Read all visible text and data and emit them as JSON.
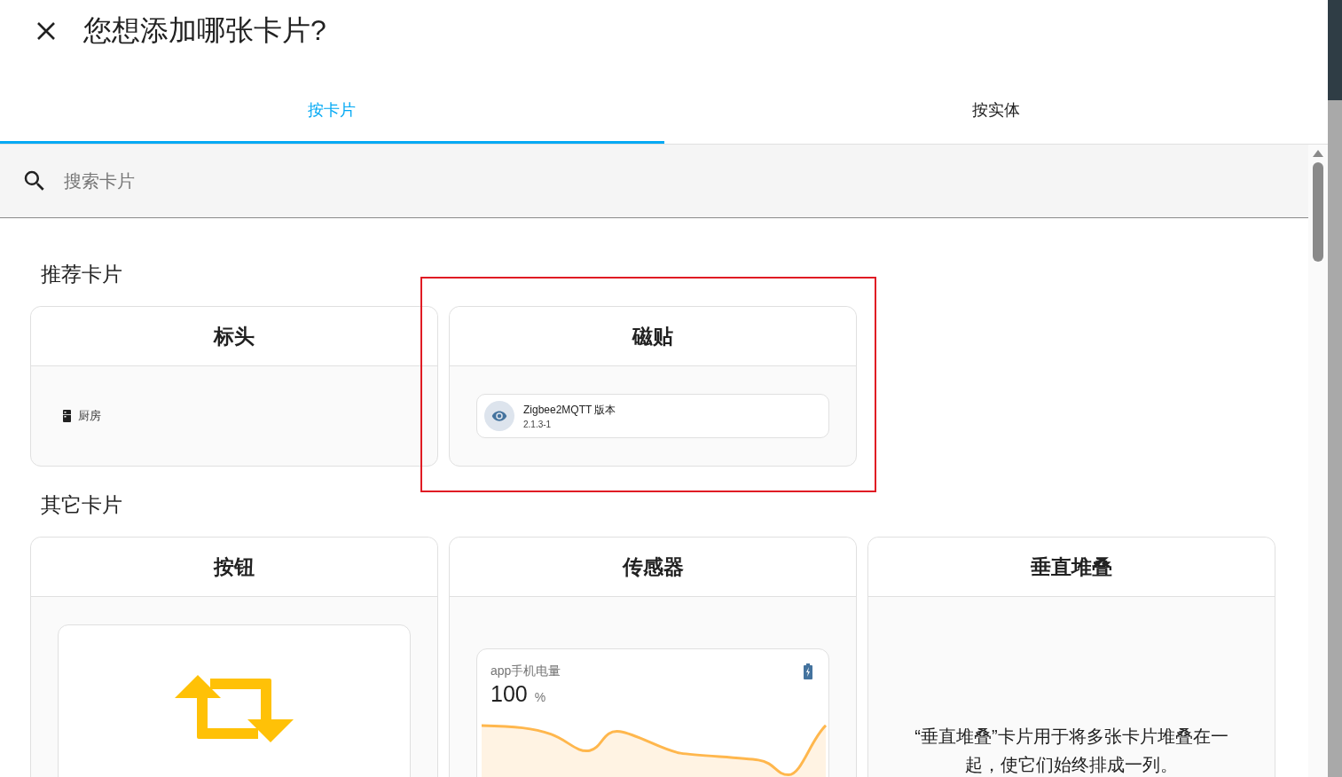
{
  "dialog": {
    "title": "您想添加哪张卡片?"
  },
  "tabs": [
    {
      "label": "按卡片",
      "selected": true
    },
    {
      "label": "按实体",
      "selected": false
    }
  ],
  "search": {
    "placeholder": "搜索卡片"
  },
  "sections": [
    {
      "title": "推荐卡片",
      "cards": [
        {
          "kind": "heading",
          "title": "标头",
          "highlighted": false,
          "entity": "厨房"
        },
        {
          "kind": "tile",
          "title": "磁贴",
          "highlighted": true,
          "name": "Zigbee2MQTT 版本",
          "state": "2.1.3-1"
        }
      ]
    },
    {
      "title": "其它卡片",
      "cards": [
        {
          "kind": "button",
          "title": "按钮",
          "highlighted": false
        },
        {
          "kind": "sensor",
          "title": "传感器",
          "highlighted": false,
          "name": "app手机电量",
          "value": "100",
          "unit": "%"
        },
        {
          "kind": "description",
          "title": "垂直堆叠",
          "highlighted": false,
          "text": "“垂直堆叠”卡片用于将多张卡片堆叠在一起，使它们始终排成一列。"
        }
      ]
    }
  ]
}
